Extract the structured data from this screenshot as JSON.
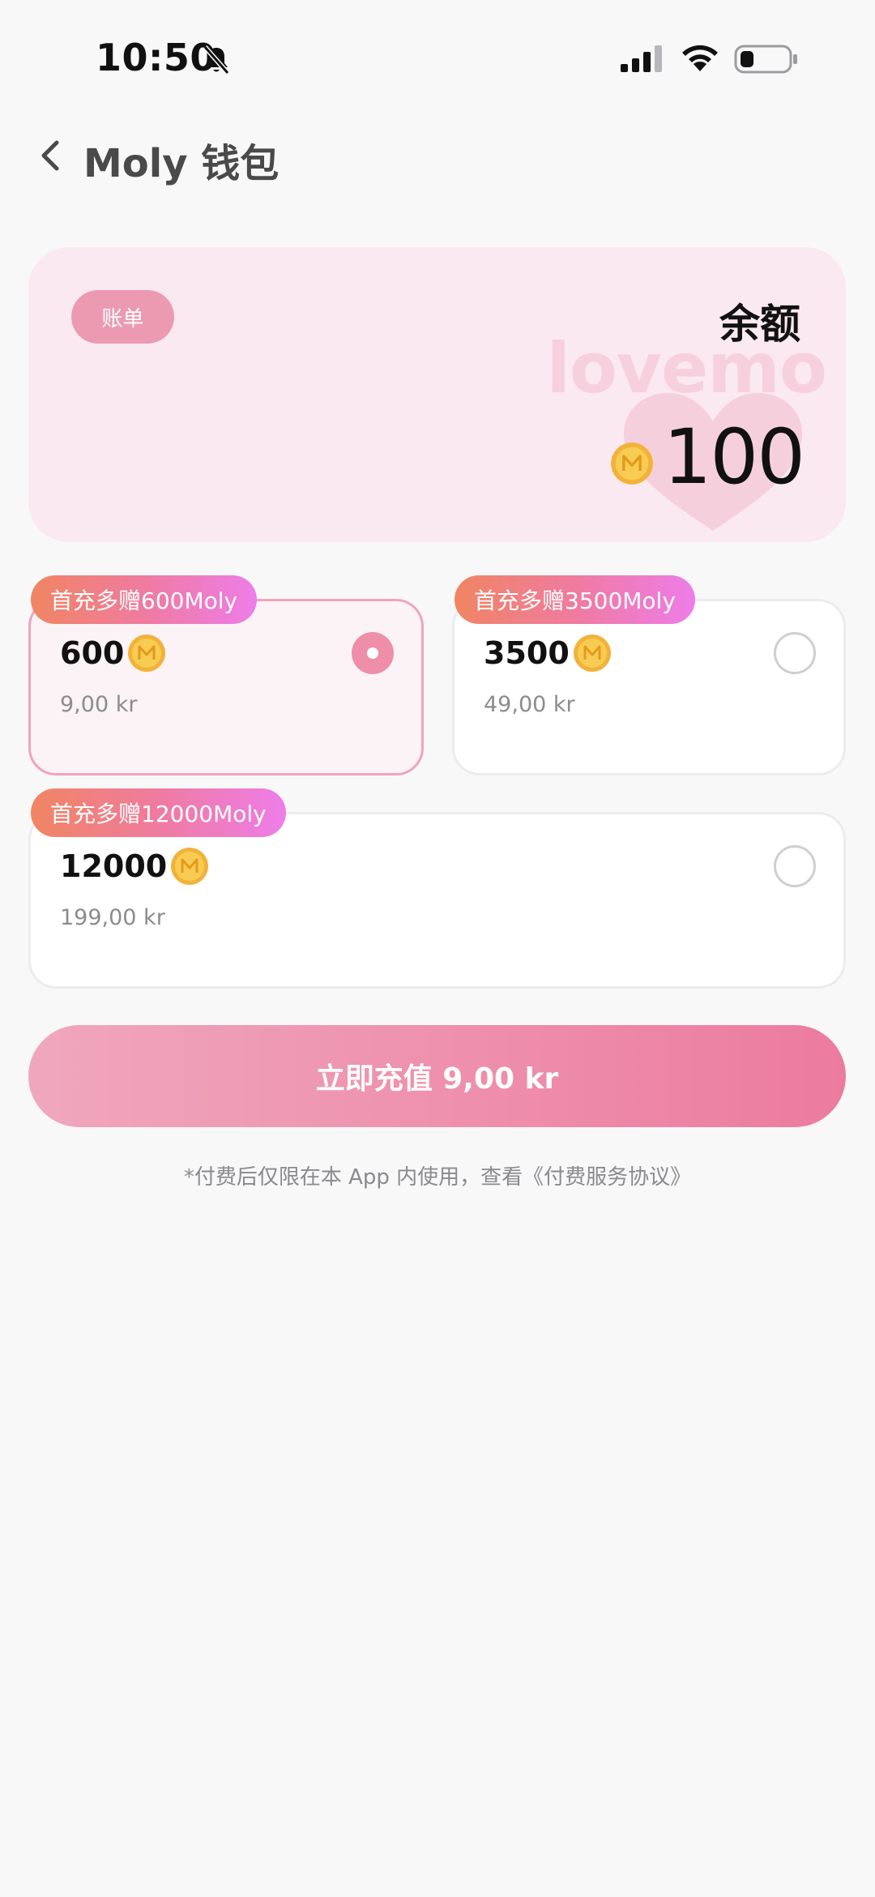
{
  "status_bar": {
    "time": "10:50",
    "icons": [
      "bell-muted-icon",
      "signal-icon",
      "wifi-icon",
      "battery-icon"
    ]
  },
  "header": {
    "title": "Moly 钱包",
    "back_icon": "chevron-left-icon"
  },
  "balance": {
    "bill_label": "账单",
    "label": "余额",
    "value": "100",
    "watermark": "lovemo",
    "coin_icon": "moly-coin-icon"
  },
  "packages": [
    {
      "tag": "首充多赠600Moly",
      "amount": "600",
      "price": "9,00 kr",
      "selected": true
    },
    {
      "tag": "首充多赠3500Moly",
      "amount": "3500",
      "price": "49,00 kr",
      "selected": false
    },
    {
      "tag": "首充多赠12000Moly",
      "amount": "12000",
      "price": "199,00 kr",
      "selected": false
    }
  ],
  "pay_button": {
    "label": "立即充值 9,00 kr"
  },
  "agreement": {
    "prefix": "*付费后仅限在本 App 内使用，查看",
    "link": "《付费服务协议》"
  },
  "colors": {
    "accent": "#ec7b9f",
    "card_bg": "#fae9f0",
    "tag_gradient": [
      "#f08562",
      "#ef7ba0",
      "#ee7de9"
    ],
    "coin": "#f4b73a"
  }
}
